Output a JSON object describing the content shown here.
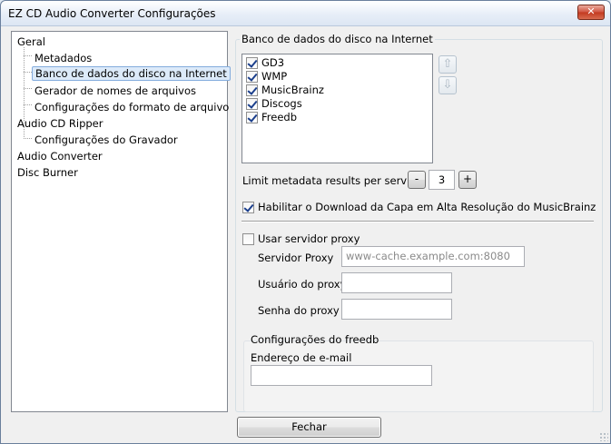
{
  "window": {
    "title": "EZ CD Audio Converter Configurações",
    "close_glyph": "✕"
  },
  "tree": {
    "items": [
      {
        "label": "Geral"
      },
      {
        "label": "Metadados"
      },
      {
        "label": "Banco de dados do disco na Internet",
        "selected": true
      },
      {
        "label": "Gerador de nomes de arquivos"
      },
      {
        "label": "Configurações do formato de arquivo"
      },
      {
        "label": "Audio CD Ripper"
      },
      {
        "label": "Configurações do Gravador"
      },
      {
        "label": "Audio Converter"
      },
      {
        "label": "Disc Burner"
      }
    ]
  },
  "internet_db": {
    "group_title": "Banco de dados do disco na Internet",
    "services": [
      {
        "label": "GD3",
        "checked": true
      },
      {
        "label": "WMP",
        "checked": true
      },
      {
        "label": "MusicBrainz",
        "checked": true
      },
      {
        "label": "Discogs",
        "checked": true
      },
      {
        "label": "Freedb",
        "checked": true
      }
    ],
    "move_up_icon": "arrow-up-icon",
    "move_down_icon": "arrow-down-icon",
    "limit_label": "Limit metadata results per service",
    "limit_minus": "-",
    "limit_value": "3",
    "limit_plus": "+",
    "hires_cover_label": "Habilitar o Download da Capa em Alta Resolução do MusicBrainz",
    "hires_cover_checked": true
  },
  "proxy": {
    "use_proxy_label": "Usar servidor proxy",
    "use_proxy_checked": false,
    "server_label": "Servidor Proxy",
    "server_placeholder": "www-cache.example.com:8080",
    "user_label": "Usuário do proxy",
    "user_value": "",
    "password_label": "Senha do proxy",
    "password_value": ""
  },
  "freedb": {
    "group_title": "Configurações do freedb",
    "email_label": "Endereço de e-mail",
    "email_value": ""
  },
  "footer": {
    "close_label": "Fechar"
  }
}
